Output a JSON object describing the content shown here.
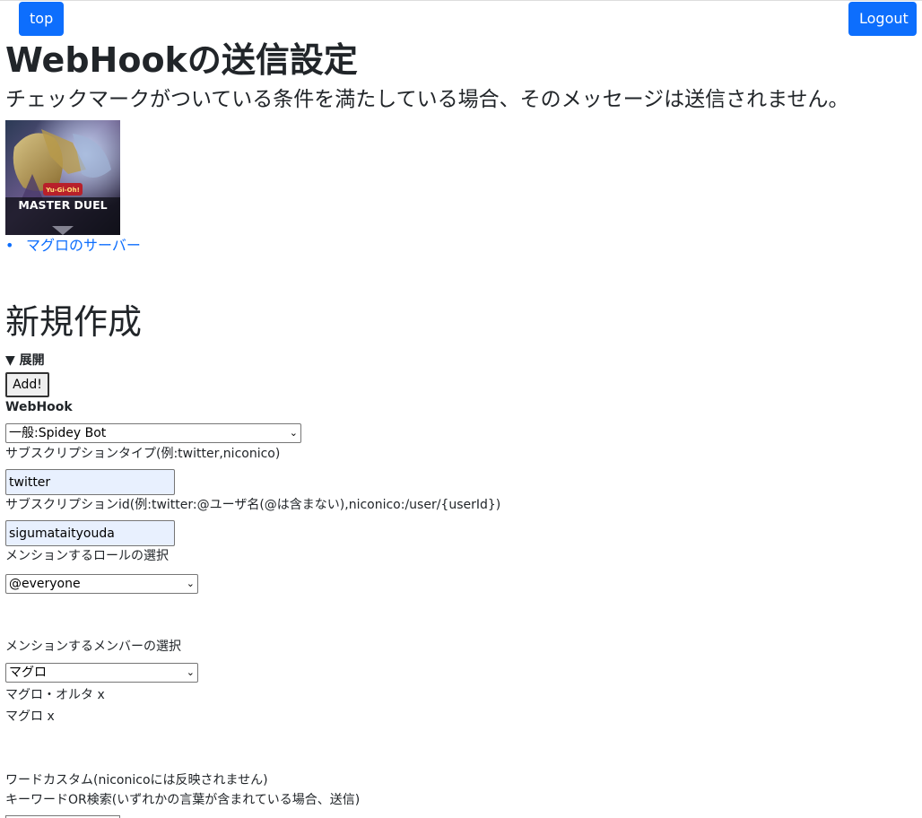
{
  "nav": {
    "top_label": "top",
    "logout_label": "Logout",
    "accent": "#0d6efd"
  },
  "header": {
    "title": "WebHookの送信設定",
    "subtitle": "チェックマークがついている条件を満たしている場合、そのメッセージは送信されません。"
  },
  "server": {
    "icon_name": "server-icon",
    "image_text_line1": "Yu-Gi-Oh!",
    "image_text_line2": "MASTER DUEL",
    "list_item": "マグロのサーバー"
  },
  "create": {
    "heading": "新規作成",
    "summary": "▼ 展開",
    "add_label": "Add!",
    "webhook_label": "WebHook",
    "webhook_selected": "一般:Spidey Bot",
    "subscription_type_label": "サブスクリプションタイプ(例:twitter,niconico)",
    "subscription_type_value": "twitter",
    "subscription_id_label": "サブスクリプションid(例:twitter:@ユーザ名(@は含まない),niconico:/user/{userId})",
    "subscription_id_value": "sigumataityouda",
    "role_label": "メンションするロールの選択",
    "role_selected": "@everyone",
    "member_label": "メンションするメンバーの選択",
    "member_selected": "マグロ",
    "members": [
      "マグロ・オルタ x",
      "マグロ x"
    ],
    "word_custom_label": "ワードカスタム(niconicoには反映されません)",
    "keyword_or_label": "キーワードOR検索(いずれかの言葉が含まれている場合、送信)"
  }
}
